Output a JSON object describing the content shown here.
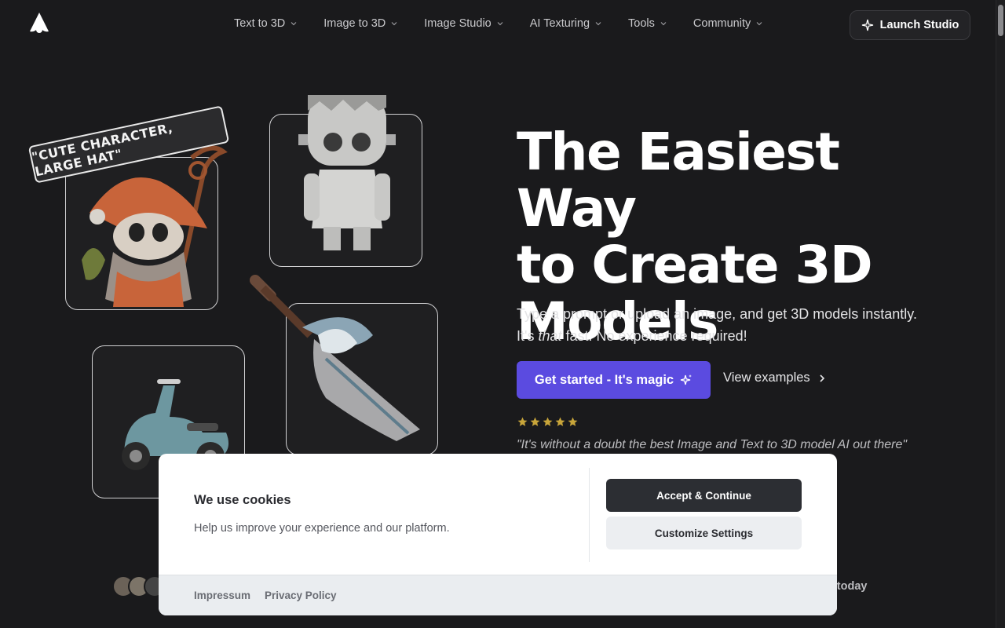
{
  "nav": {
    "items": [
      {
        "label": "Text to 3D"
      },
      {
        "label": "Image to 3D"
      },
      {
        "label": "Image Studio"
      },
      {
        "label": "AI Texturing"
      },
      {
        "label": "Tools"
      },
      {
        "label": "Community"
      }
    ],
    "launch_label": "Launch Studio"
  },
  "art": {
    "tag_label": "\"CUTE CHARACTER, LARGE HAT\""
  },
  "hero": {
    "title_line1": "The Easiest Way",
    "title_line2": "to Create 3D",
    "title_line3": "Models",
    "sub_line1": "Type a prompt or upload an image, and get 3D models instantly.",
    "sub_pre": "It's ",
    "sub_em": "that",
    "sub_post": " fast. No experience required!",
    "cta_label": "Get started - It's magic",
    "view_label": "View examples",
    "rating": 5,
    "quote": "\"It's without a doubt the best Image and Text to 3D model AI out there\""
  },
  "social": {
    "joined_text": "ted today"
  },
  "cookie": {
    "title": "We use cookies",
    "text": "Help us improve your experience and our platform.",
    "accept_label": "Accept & Continue",
    "customize_label": "Customize Settings",
    "impressum": "Impressum",
    "privacy": "Privacy Policy"
  },
  "colors": {
    "background": "#1a1a1c",
    "accent": "#5b4be0",
    "star": "#c8a53a"
  }
}
